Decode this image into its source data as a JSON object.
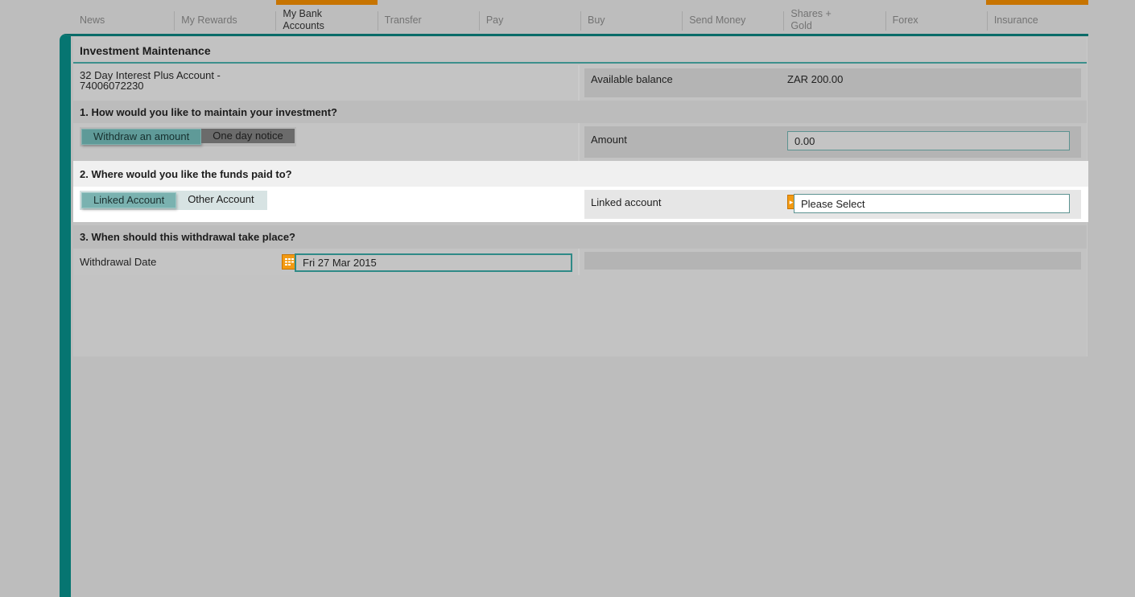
{
  "nav": {
    "items": [
      {
        "label": "News"
      },
      {
        "label": "My Rewards"
      },
      {
        "label": "My Bank Accounts",
        "active": true
      },
      {
        "label": "Transfer"
      },
      {
        "label": "Pay"
      },
      {
        "label": "Buy"
      },
      {
        "label": "Send Money"
      },
      {
        "label": "Shares + Gold"
      },
      {
        "label": "Forex"
      },
      {
        "label": "Insurance"
      }
    ],
    "line1": [
      "News",
      "My Rewards",
      "My Bank",
      "Transfer",
      "Pay",
      "Buy",
      "Send Money",
      "Shares +",
      "Forex",
      "Insurance"
    ],
    "line2": [
      "",
      "",
      "Accounts",
      "",
      "",
      "",
      "",
      "Gold",
      "",
      ""
    ]
  },
  "page": {
    "title": "Investment Maintenance",
    "account_name_line1": "32 Day Interest Plus Account -",
    "account_name_line2": "74006072230",
    "available_balance_label": "Available balance",
    "available_balance_value": "ZAR 200.00"
  },
  "section1": {
    "question": "1. How would you like to maintain your investment?",
    "options": [
      "Withdraw an amount",
      "One day notice"
    ],
    "selected": "Withdraw an amount",
    "amount_label": "Amount",
    "amount_value": "0.00"
  },
  "section2": {
    "question": "2. Where would you like the funds paid to?",
    "options": [
      "Linked Account",
      "Other Account"
    ],
    "selected": "Linked Account",
    "linked_account_label": "Linked account",
    "linked_account_value": "Please Select"
  },
  "section3": {
    "question": "3. When should this withdrawal take place?",
    "date_label": "Withdrawal Date",
    "date_value": "Fri 27 Mar 2015"
  },
  "colors": {
    "accent_teal": "#067571",
    "orange": "#f39a12"
  }
}
